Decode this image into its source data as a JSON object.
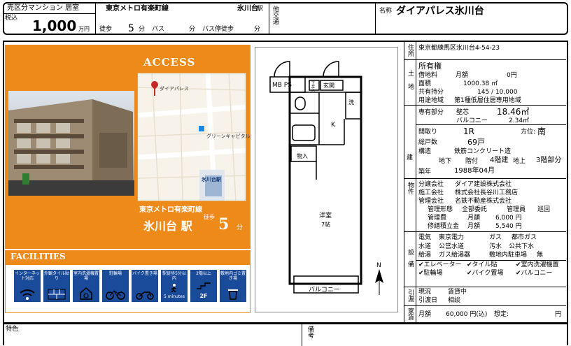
{
  "header": {
    "type_label": "売区分マンション 居室",
    "tax_label": "税込",
    "price": "1,000",
    "price_unit": "万円",
    "line": "東京メトロ有楽町線",
    "station": "氷川台",
    "station_suffix": "駅",
    "walk_label": "徒歩",
    "walk_min": "5",
    "min_unit": "分",
    "bus_label": "バス",
    "bus_min_unit": "分",
    "bus_walk_label": "バス停徒歩",
    "bus_walk_unit": "分",
    "other_traffic_label": "他交通",
    "name_label": "名称",
    "name": "ダイアパレス氷川台"
  },
  "access": {
    "title": "ACCESS",
    "map_place": "ダイアパレス",
    "map_shop": "グリーンキャピタル",
    "map_station": "氷川台駅",
    "line": "東京メトロ有楽町線",
    "station": "氷川台 駅",
    "walk": "徒歩",
    "minutes": "5",
    "min_unit": "分"
  },
  "facilities": {
    "title": "FACILITIES",
    "items": [
      {
        "label": "インターネット対応",
        "icon": "wifi-icon"
      },
      {
        "label": "外観タイル貼り",
        "icon": "brick-wall-icon"
      },
      {
        "label": "室内洗濯機置場",
        "icon": "washing-machine-icon"
      },
      {
        "label": "駐輪場",
        "icon": "bicycle-icon"
      },
      {
        "label": "バイク置き場",
        "icon": "motorbike-icon"
      },
      {
        "label": "駅徒歩5分以内",
        "icon": "walking-person-icon",
        "sub": "5 minutes"
      },
      {
        "label": "2階以上",
        "icon": "stairs-icon",
        "sub": "2F"
      },
      {
        "label": "敷地内ゴミ置き場",
        "icon": "trash-icon"
      }
    ]
  },
  "floorplan": {
    "mb_ps": "MB PS",
    "shoe": "下足入",
    "entrance": "玄関",
    "wash": "洗",
    "kitchen": "K",
    "closet": "物入",
    "room": "洋室",
    "room_size": "7帖",
    "balcony": "バルコニー",
    "north": "N"
  },
  "details": {
    "address_label": "住所",
    "address": "東京都練馬区氷川台4-54-23",
    "land_label": "土地",
    "ownership": "所有権",
    "lease_label": "借地料",
    "lease_monthly": "月額",
    "lease_value": "0円",
    "area_label": "面積",
    "area_value": "1000.38 ㎡",
    "share_label": "共有持分",
    "share_value": "145 / 10,000",
    "zone_label": "用途地域",
    "zone_value": "第1種低層住居専用地域",
    "building_label": "建",
    "private_label": "専有部分",
    "wall_label": "壁芯",
    "private_area": "18.46㎡",
    "balcony_label": "バルコニー",
    "balcony_area": "2.34㎡",
    "layout_label": "間取り",
    "layout": "1R",
    "direction_label": "方位:",
    "direction": "南",
    "units_label": "総戸数",
    "units": "69戸",
    "structure_label": "構造",
    "structure": "鉄筋コンクリート造",
    "underground_label": "地下",
    "floor_label": "階付",
    "floor": "4階建",
    "above_label": "地上",
    "located": "3階部分",
    "built_label": "築年",
    "built": "1988年04月",
    "property_label": "物件",
    "seller_label": "分譲会社",
    "seller": "ダイア建設株式会社",
    "constructor_label": "施工会社",
    "constructor": "株式会社長谷川工務店",
    "manager_label": "管理会社",
    "manager": "名鉄不動産株式会社",
    "mgmt_type_label": "管理形態",
    "mgmt_type": "全部委託",
    "caretaker_label": "管理員",
    "caretaker": "巡回",
    "mgmt_fee_label": "管理費",
    "mgmt_fee_monthly": "月額",
    "mgmt_fee": "6,000 円",
    "repair_label": "修繕積立金",
    "repair_monthly": "月額",
    "repair_fee": "5,540 円",
    "equip_label": "設備",
    "elec_label": "電気",
    "elec": "東京電力",
    "gas_label": "ガス",
    "gas": "都市ガス",
    "water_label": "水道",
    "water": "公営水道",
    "sewage_label": "汚水",
    "sewage": "公共下水",
    "hotwater_label": "給湯",
    "hotwater": "ガス給湯器",
    "parking_label": "敷地内駐車場",
    "parking": "無",
    "checks": [
      "エレベーター",
      "タイル貼",
      "室内洗濯機置",
      "駐輪場",
      "バイク置場",
      "バルコニー"
    ],
    "delivery_label": "引渡",
    "status_label": "現況",
    "status": "賃貸中",
    "delivery_date_label": "引渡日",
    "delivery_date": "相談",
    "rent_label": "家賃",
    "rent_monthly": "月額",
    "rent": "60,000 円(込)",
    "expected_label": "想定:",
    "expected_unit": "円"
  },
  "footer": {
    "special_label": "特色",
    "remarks_label": "備考"
  }
}
